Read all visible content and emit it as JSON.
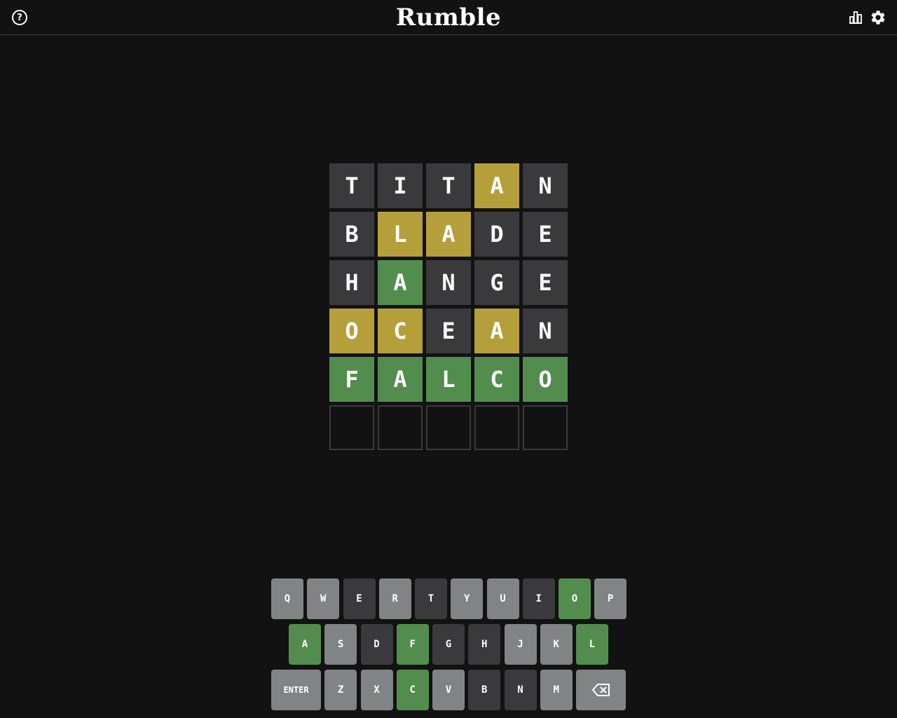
{
  "header": {
    "title": "Rumble",
    "help_glyph": "?"
  },
  "board": {
    "rows": [
      [
        {
          "letter": "T",
          "state": "absent"
        },
        {
          "letter": "I",
          "state": "absent"
        },
        {
          "letter": "T",
          "state": "absent"
        },
        {
          "letter": "A",
          "state": "present"
        },
        {
          "letter": "N",
          "state": "absent"
        }
      ],
      [
        {
          "letter": "B",
          "state": "absent"
        },
        {
          "letter": "L",
          "state": "present"
        },
        {
          "letter": "A",
          "state": "present"
        },
        {
          "letter": "D",
          "state": "absent"
        },
        {
          "letter": "E",
          "state": "absent"
        }
      ],
      [
        {
          "letter": "H",
          "state": "absent"
        },
        {
          "letter": "A",
          "state": "correct"
        },
        {
          "letter": "N",
          "state": "absent"
        },
        {
          "letter": "G",
          "state": "absent"
        },
        {
          "letter": "E",
          "state": "absent"
        }
      ],
      [
        {
          "letter": "O",
          "state": "present"
        },
        {
          "letter": "C",
          "state": "present"
        },
        {
          "letter": "E",
          "state": "absent"
        },
        {
          "letter": "A",
          "state": "present"
        },
        {
          "letter": "N",
          "state": "absent"
        }
      ],
      [
        {
          "letter": "F",
          "state": "correct"
        },
        {
          "letter": "A",
          "state": "correct"
        },
        {
          "letter": "L",
          "state": "correct"
        },
        {
          "letter": "C",
          "state": "correct"
        },
        {
          "letter": "O",
          "state": "correct"
        }
      ],
      [
        {
          "letter": "",
          "state": "empty"
        },
        {
          "letter": "",
          "state": "empty"
        },
        {
          "letter": "",
          "state": "empty"
        },
        {
          "letter": "",
          "state": "empty"
        },
        {
          "letter": "",
          "state": "empty"
        }
      ]
    ]
  },
  "keyboard": {
    "rows": [
      [
        {
          "label": "Q",
          "state": "unused"
        },
        {
          "label": "W",
          "state": "unused"
        },
        {
          "label": "E",
          "state": "absent"
        },
        {
          "label": "R",
          "state": "unused"
        },
        {
          "label": "T",
          "state": "absent"
        },
        {
          "label": "Y",
          "state": "unused"
        },
        {
          "label": "U",
          "state": "unused"
        },
        {
          "label": "I",
          "state": "absent"
        },
        {
          "label": "O",
          "state": "correct"
        },
        {
          "label": "P",
          "state": "unused"
        }
      ],
      [
        {
          "label": "A",
          "state": "correct"
        },
        {
          "label": "S",
          "state": "unused"
        },
        {
          "label": "D",
          "state": "absent"
        },
        {
          "label": "F",
          "state": "correct"
        },
        {
          "label": "G",
          "state": "absent"
        },
        {
          "label": "H",
          "state": "absent"
        },
        {
          "label": "J",
          "state": "unused"
        },
        {
          "label": "K",
          "state": "unused"
        },
        {
          "label": "L",
          "state": "correct"
        }
      ],
      [
        {
          "label": "ENTER",
          "state": "unused",
          "wide": true
        },
        {
          "label": "Z",
          "state": "unused"
        },
        {
          "label": "X",
          "state": "unused"
        },
        {
          "label": "C",
          "state": "correct"
        },
        {
          "label": "V",
          "state": "unused"
        },
        {
          "label": "B",
          "state": "absent"
        },
        {
          "label": "N",
          "state": "absent"
        },
        {
          "label": "M",
          "state": "unused"
        },
        {
          "label": "",
          "state": "unused",
          "wide": true,
          "icon": "backspace-icon"
        }
      ]
    ]
  },
  "colors": {
    "background": "#121213",
    "absent": "#3a3a3c",
    "present": "#b59f3b",
    "correct": "#538d4e",
    "key_unused": "#818384"
  },
  "icons": {
    "help": "help-icon",
    "stats": "stats-icon",
    "settings": "gear-icon",
    "backspace": "backspace-icon"
  }
}
